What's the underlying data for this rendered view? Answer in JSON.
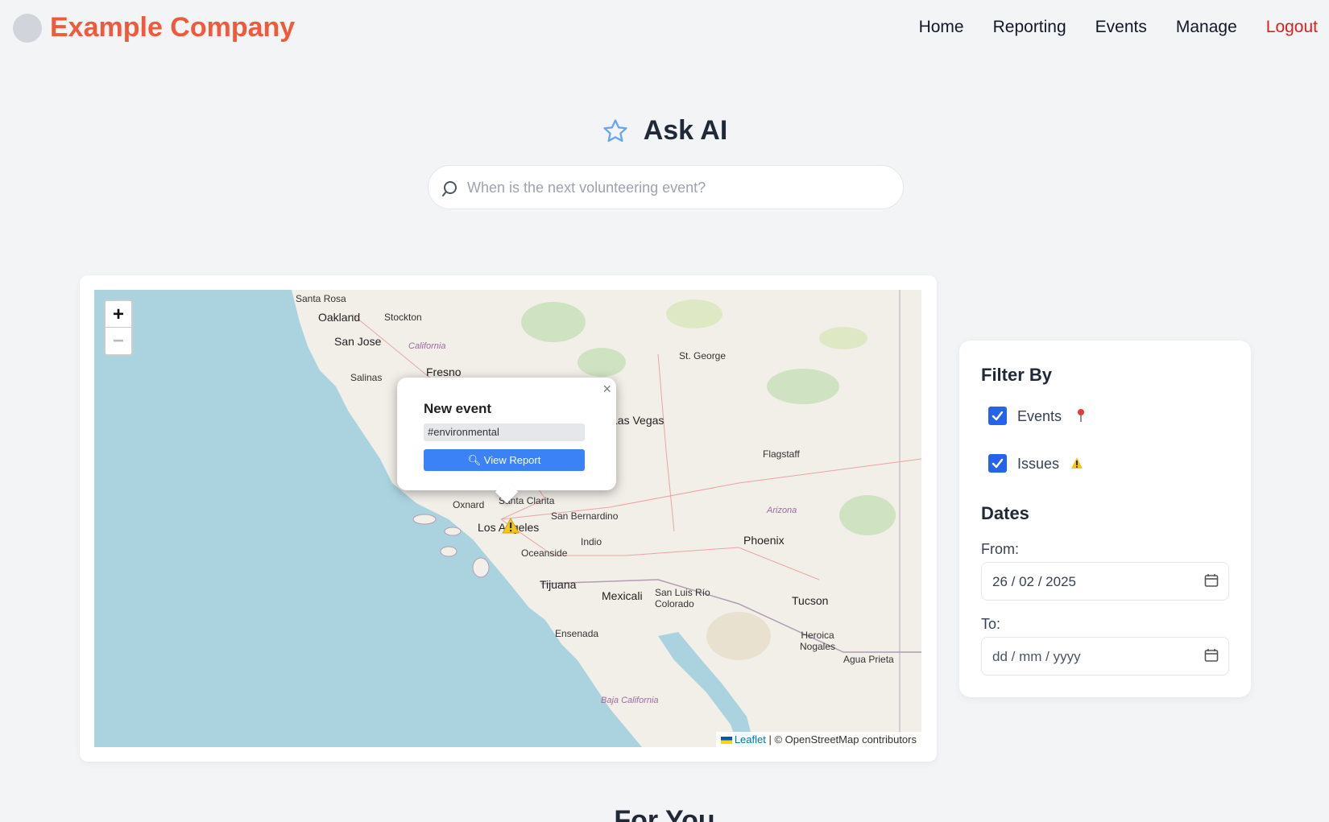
{
  "header": {
    "brand": "Example Company",
    "nav": [
      "Home",
      "Reporting",
      "Events",
      "Manage",
      "Logout"
    ]
  },
  "ask": {
    "title": "Ask AI",
    "placeholder": "When is the next volunteering event?"
  },
  "map": {
    "zoom_in": "+",
    "zoom_out": "−",
    "labels": [
      "Santa Rosa",
      "Oakland",
      "Stockton",
      "San Jose",
      "California",
      "Fresno",
      "Salinas",
      "St. George",
      "Las Vegas",
      "Flagstaff",
      "Santa Clarita",
      "Oxnard",
      "San Bernardino",
      "Los Angeles",
      "Indio",
      "Arizona",
      "Phoenix",
      "Oceanside",
      "Tijuana",
      "Mexicali",
      "San Luis Río Colorado",
      "Tucson",
      "Ensenada",
      "Heroica Nogales",
      "Agua Prieta",
      "Baja California"
    ],
    "popup": {
      "title": "New event",
      "tag": "#environmental",
      "button": "View Report",
      "close": "×"
    },
    "attribution": {
      "leaflet": "Leaflet",
      "rest": "| © OpenStreetMap contributors"
    }
  },
  "filter": {
    "title": "Filter By",
    "events_label": "Events",
    "issues_label": "Issues",
    "dates_title": "Dates",
    "from_label": "From:",
    "from_value": "26 / 02 / 2025",
    "to_label": "To:",
    "to_value": "dd / mm / yyyy"
  },
  "for_you": "For You",
  "colors": {
    "brand": "#f05a3a",
    "logout": "#e11d1d",
    "accent": "#3b82f6",
    "checkbox": "#2563eb",
    "water": "#aad3df"
  }
}
